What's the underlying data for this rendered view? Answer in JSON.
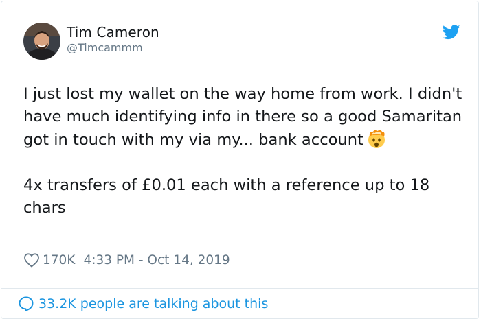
{
  "tweet": {
    "author_name": "Tim Cameron",
    "author_handle": "@Timcammm",
    "paragraph_1": "I just lost my wallet on the way home from work. I didn't have much identifying info in there so a good Samaritan got in touch with my via my... bank account",
    "paragraph_2": "4x transfers of £0.01 each with a reference up to 18 chars",
    "likes": "170K",
    "timestamp": "4:33 PM - Oct 14, 2019",
    "talking_text": "33.2K people are talking about this"
  },
  "icons": {
    "brand": "twitter-bird-icon",
    "like": "heart-outline-icon",
    "reply": "speech-bubble-icon",
    "reaction": "exploding-head-emoji"
  },
  "colors": {
    "twitter_blue": "#1da1f2",
    "link_blue": "#1b95e0",
    "secondary_text": "#657786",
    "border": "#e1e8ed"
  }
}
